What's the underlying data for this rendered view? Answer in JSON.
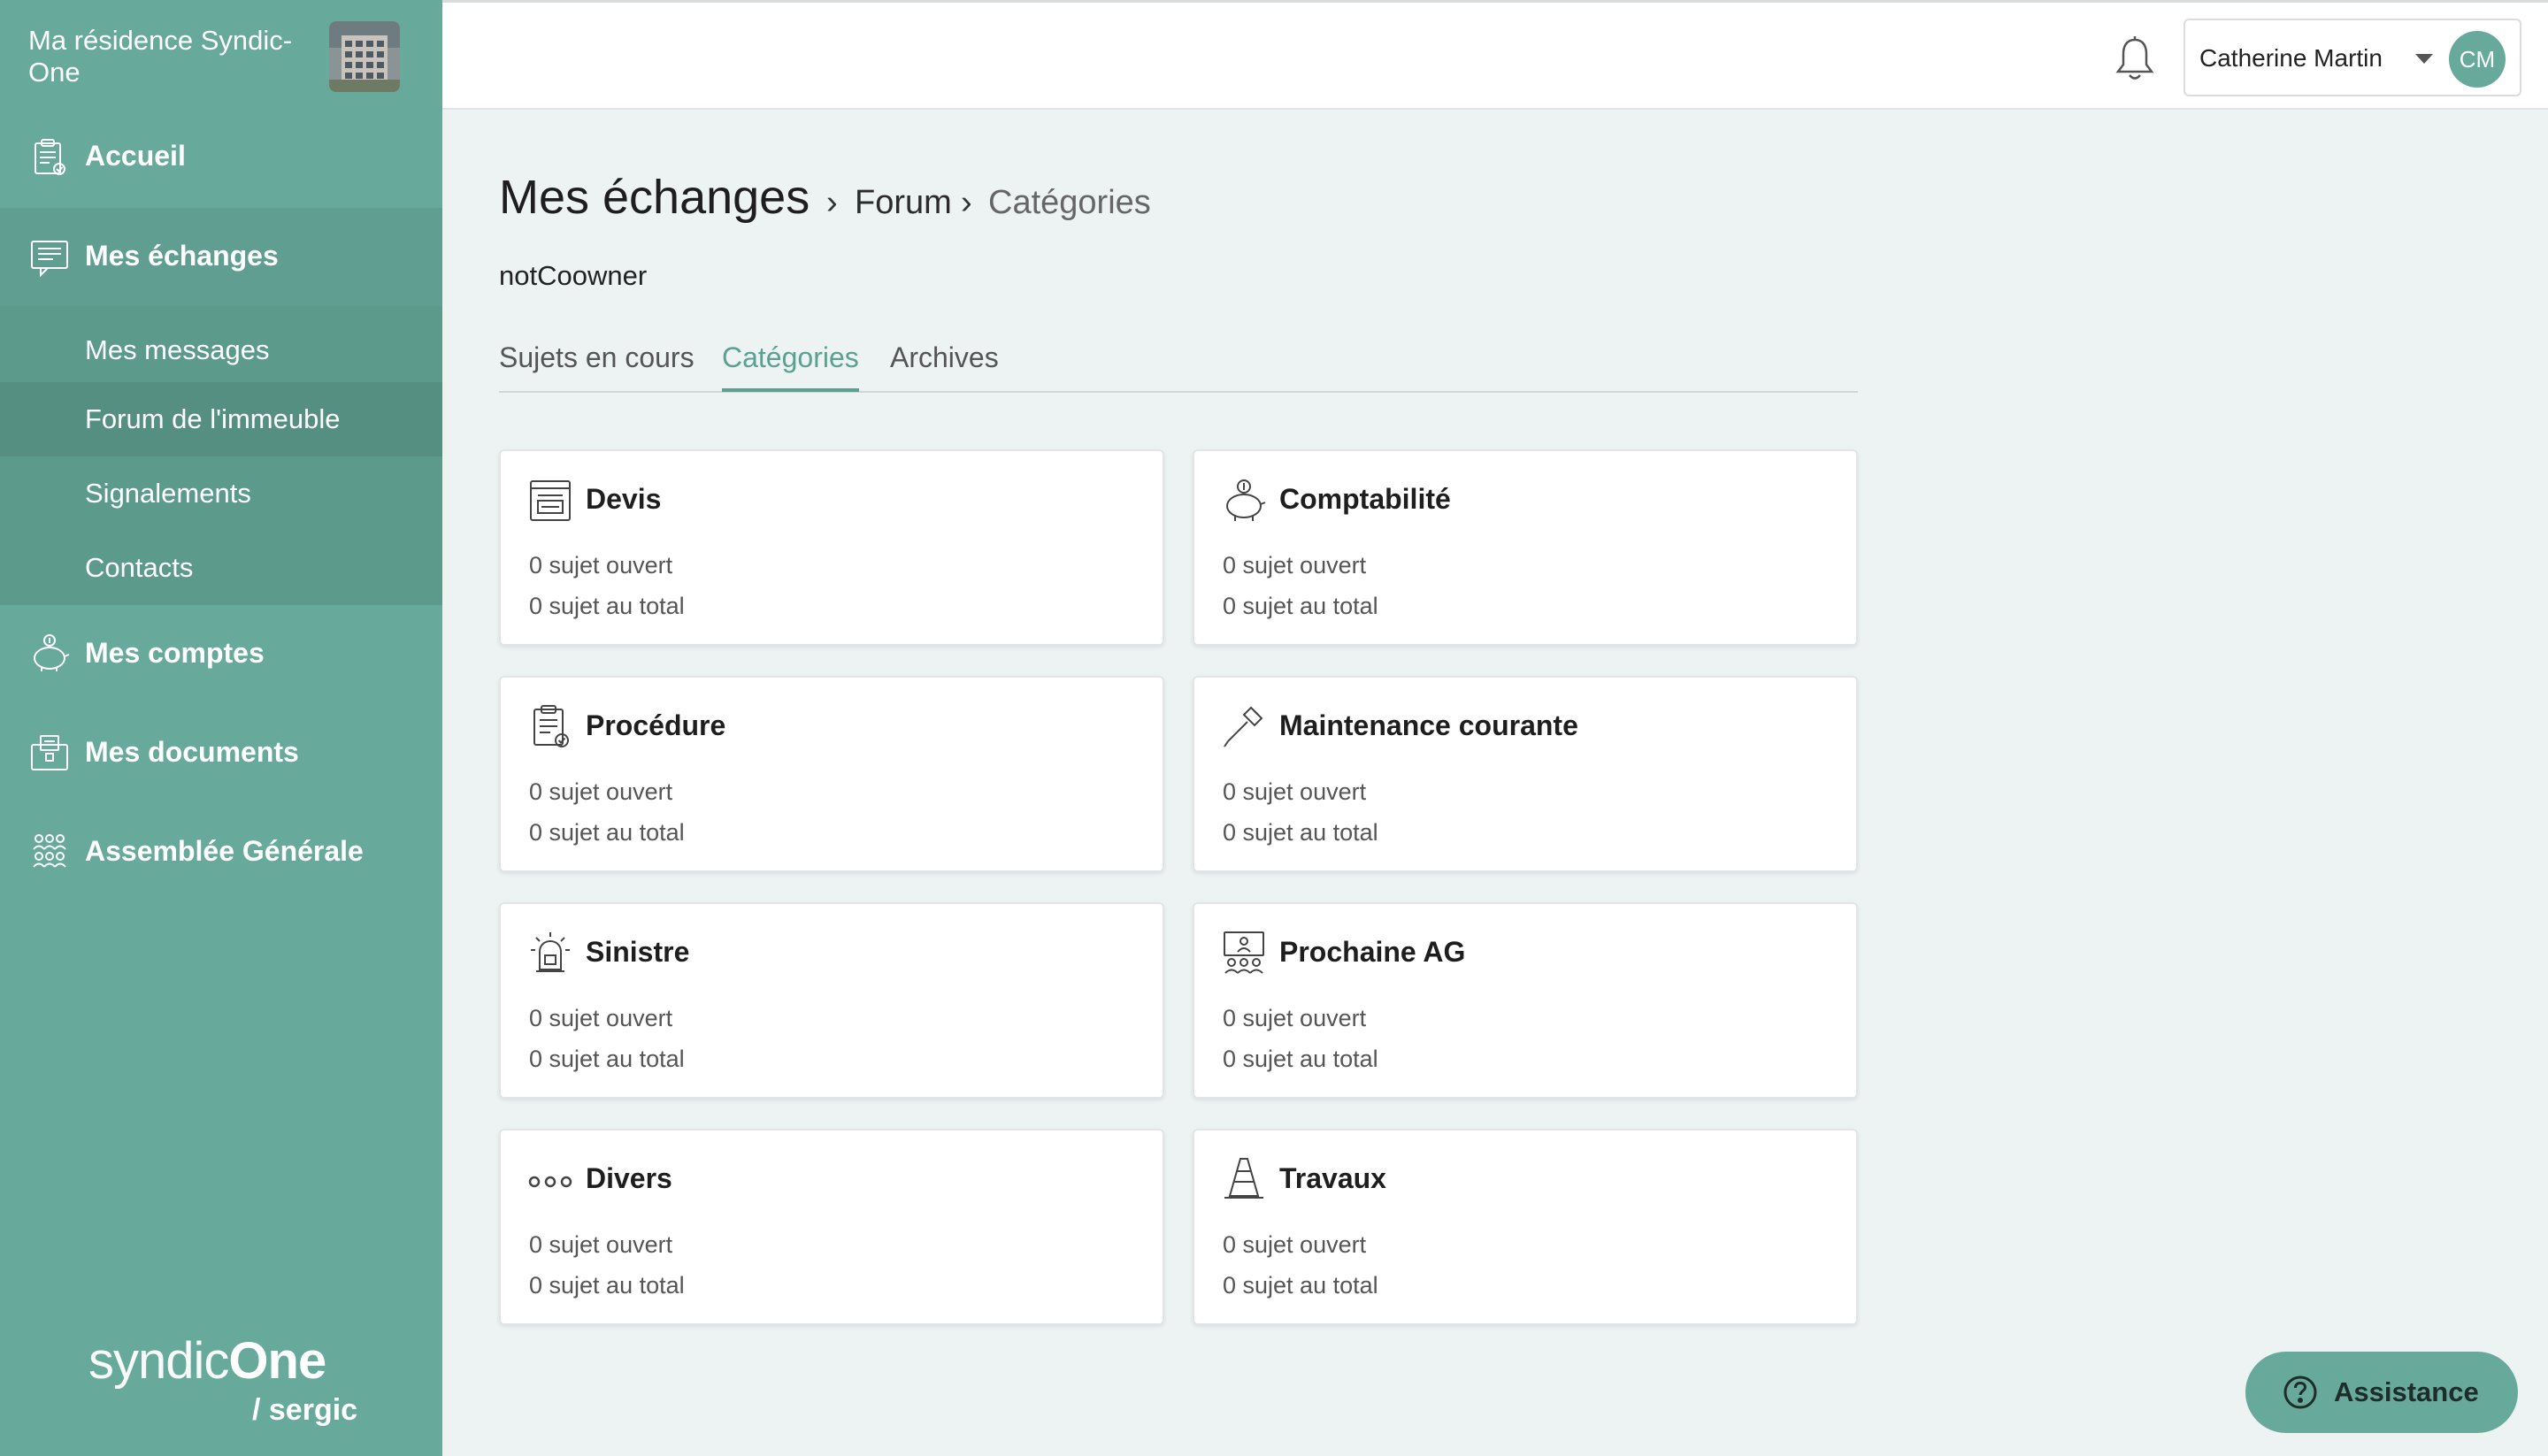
{
  "sidebar": {
    "residence_name": "Ma résidence Syndic-One",
    "nav": {
      "accueil": "Accueil",
      "echanges": "Mes échanges",
      "comptes": "Mes comptes",
      "documents": "Mes documents",
      "ag": "Assemblée Générale"
    },
    "submenu": [
      "Mes messages",
      "Forum de l'immeuble",
      "Signalements",
      "Contacts"
    ],
    "active_submenu": "Forum de l'immeuble",
    "brand": {
      "main_light": "syndic",
      "main_bold": "One",
      "sub": "/ sergic"
    }
  },
  "header": {
    "user_name": "Catherine Martin",
    "initials": "CM"
  },
  "page": {
    "title": "Mes échanges",
    "breadcrumb": [
      "Forum",
      "Catégories"
    ],
    "separator": "›",
    "role": "notCoowner",
    "tabs": [
      "Sujets en cours",
      "Catégories",
      "Archives"
    ],
    "active_tab": "Catégories"
  },
  "categories": [
    {
      "icon": "quote-document-icon",
      "title": "Devis",
      "open": "0 sujet ouvert",
      "total": "0 sujet au total"
    },
    {
      "icon": "piggy-bank-icon",
      "title": "Comptabilité",
      "open": "0 sujet ouvert",
      "total": "0 sujet au total"
    },
    {
      "icon": "clipboard-check-icon",
      "title": "Procédure",
      "open": "0 sujet ouvert",
      "total": "0 sujet au total"
    },
    {
      "icon": "screwdriver-icon",
      "title": "Maintenance courante",
      "open": "0 sujet ouvert",
      "total": "0 sujet au total"
    },
    {
      "icon": "alarm-siren-icon",
      "title": "Sinistre",
      "open": "0 sujet ouvert",
      "total": "0 sujet au total"
    },
    {
      "icon": "meeting-board-icon",
      "title": "Prochaine AG",
      "open": "0 sujet ouvert",
      "total": "0 sujet au total"
    },
    {
      "icon": "dots-icon",
      "title": "Divers",
      "open": "0 sujet ouvert",
      "total": "0 sujet au total"
    },
    {
      "icon": "traffic-cone-icon",
      "title": "Travaux",
      "open": "0 sujet ouvert",
      "total": "0 sujet au total"
    }
  ],
  "assistance": {
    "label": "Assistance"
  },
  "colors": {
    "sidebar": "#67a99a",
    "accent": "#5aa191",
    "background": "#edf2f3"
  }
}
